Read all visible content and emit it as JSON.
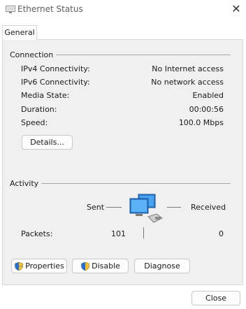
{
  "window": {
    "title": "Ethernet Status",
    "close_icon": "close-icon"
  },
  "tabs": [
    {
      "label": "General"
    }
  ],
  "connection": {
    "section_label": "Connection",
    "rows": [
      {
        "label": "IPv4 Connectivity:",
        "value": "No Internet access"
      },
      {
        "label": "IPv6 Connectivity:",
        "value": "No network access"
      },
      {
        "label": "Media State:",
        "value": "Enabled"
      },
      {
        "label": "Duration:",
        "value": "00:00:56"
      },
      {
        "label": "Speed:",
        "value": "100.0 Mbps"
      }
    ],
    "details_button": "Details..."
  },
  "activity": {
    "section_label": "Activity",
    "sent_label": "Sent",
    "received_label": "Received",
    "packets_label": "Packets:",
    "packets_sent": "101",
    "packets_received": "0",
    "icon": "network-computers-icon"
  },
  "actions": {
    "properties": "Properties",
    "disable": "Disable",
    "diagnose": "Diagnose"
  },
  "footer": {
    "close_button": "Close"
  },
  "colors": {
    "panel_bg": "#f0f0f0",
    "shield_blue": "#2a6fd1",
    "shield_yellow": "#f2c12e",
    "network_icon_blue": "#2a80d8"
  }
}
